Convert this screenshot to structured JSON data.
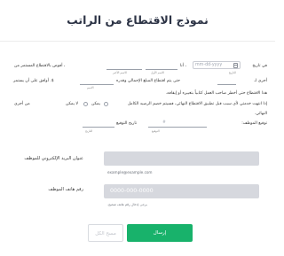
{
  "header": {
    "title": "نموذج الاقتطاع من الراتب"
  },
  "form": {
    "line1": {
      "p1": "في تاريخ",
      "date_placeholder": "mm-dd-yyyy",
      "p2": "، أنا",
      "p3": "، أفوض بالاقتطاع المستمر من",
      "name_hint": "الاسم الأول",
      "lastname_hint": "الاسم الأخير",
      "date_hint": "التاريخ"
    },
    "line2": {
      "p1": "أجري لـ",
      "p2": "حتى يتم اقتطاع المبلغ الإجمالي وقدره",
      "p3": "$. أوافق على أن يستمر",
      "amount_hint": "الاسم"
    },
    "line3": {
      "p1": "هذا الاقتطاع حتى أخطر صاحب العمل كتابياً بتغييره أو إيقافه."
    },
    "line4": {
      "p1": "إذا انتهت خدمتي لأي سبب قبل تطبيق الاقتطاع النهائي، فسيتم خصم الرصيد الكامل",
      "yes_label": "يمكن",
      "no_label": "لا يمكن",
      "p2": "من أجري"
    },
    "line5": {
      "p1": "النهائي."
    },
    "line6": {
      "p1": "توقيع الموظف:",
      "p2": "تاريخ التوقيع",
      "sig_hint": "التوقيع",
      "date_hint": "التاريخ"
    }
  },
  "email_field": {
    "label": "عنوان البريد الإلكتروني للموظف",
    "placeholder": "",
    "help": "example@example.com"
  },
  "phone_field": {
    "label": "رقم هاتف الموظف",
    "placeholder": "0000-000-0000",
    "help": "يرجى إدخال رقم هاتف صحيح."
  },
  "buttons": {
    "submit": "إرسال",
    "clear": "مسح الكل"
  }
}
